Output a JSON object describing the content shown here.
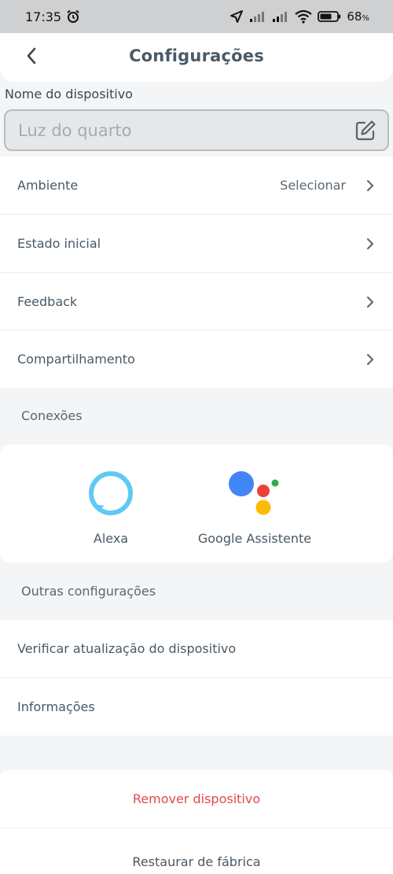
{
  "status_bar": {
    "time": "17:35",
    "battery_percent": "68",
    "battery_suffix": "%"
  },
  "header": {
    "title": "Configurações"
  },
  "device_name": {
    "label": "Nome do dispositivo",
    "placeholder": "Luz do quarto",
    "value": ""
  },
  "settings_rows": [
    {
      "label": "Ambiente",
      "value": "Selecionar"
    },
    {
      "label": "Estado inicial"
    },
    {
      "label": "Feedback"
    },
    {
      "label": "Compartilhamento"
    }
  ],
  "connections": {
    "section_label": "Conexões",
    "items": [
      {
        "label": "Alexa",
        "icon": "alexa-icon"
      },
      {
        "label": "Google Assistente",
        "icon": "google-assistant-icon"
      }
    ]
  },
  "other_settings": {
    "section_label": "Outras configurações",
    "items": [
      {
        "label": "Verificar atualização do dispositivo"
      },
      {
        "label": "Informações"
      }
    ]
  },
  "actions": {
    "remove_label": "Remover dispositivo",
    "restore_label": "Restaurar de fábrica"
  },
  "colors": {
    "accent_danger": "#e0494c",
    "alexa": "#5fc9f3",
    "google_blue": "#4285f4",
    "google_red": "#ea4335",
    "google_yellow": "#fbbc05",
    "google_green": "#34a853"
  }
}
